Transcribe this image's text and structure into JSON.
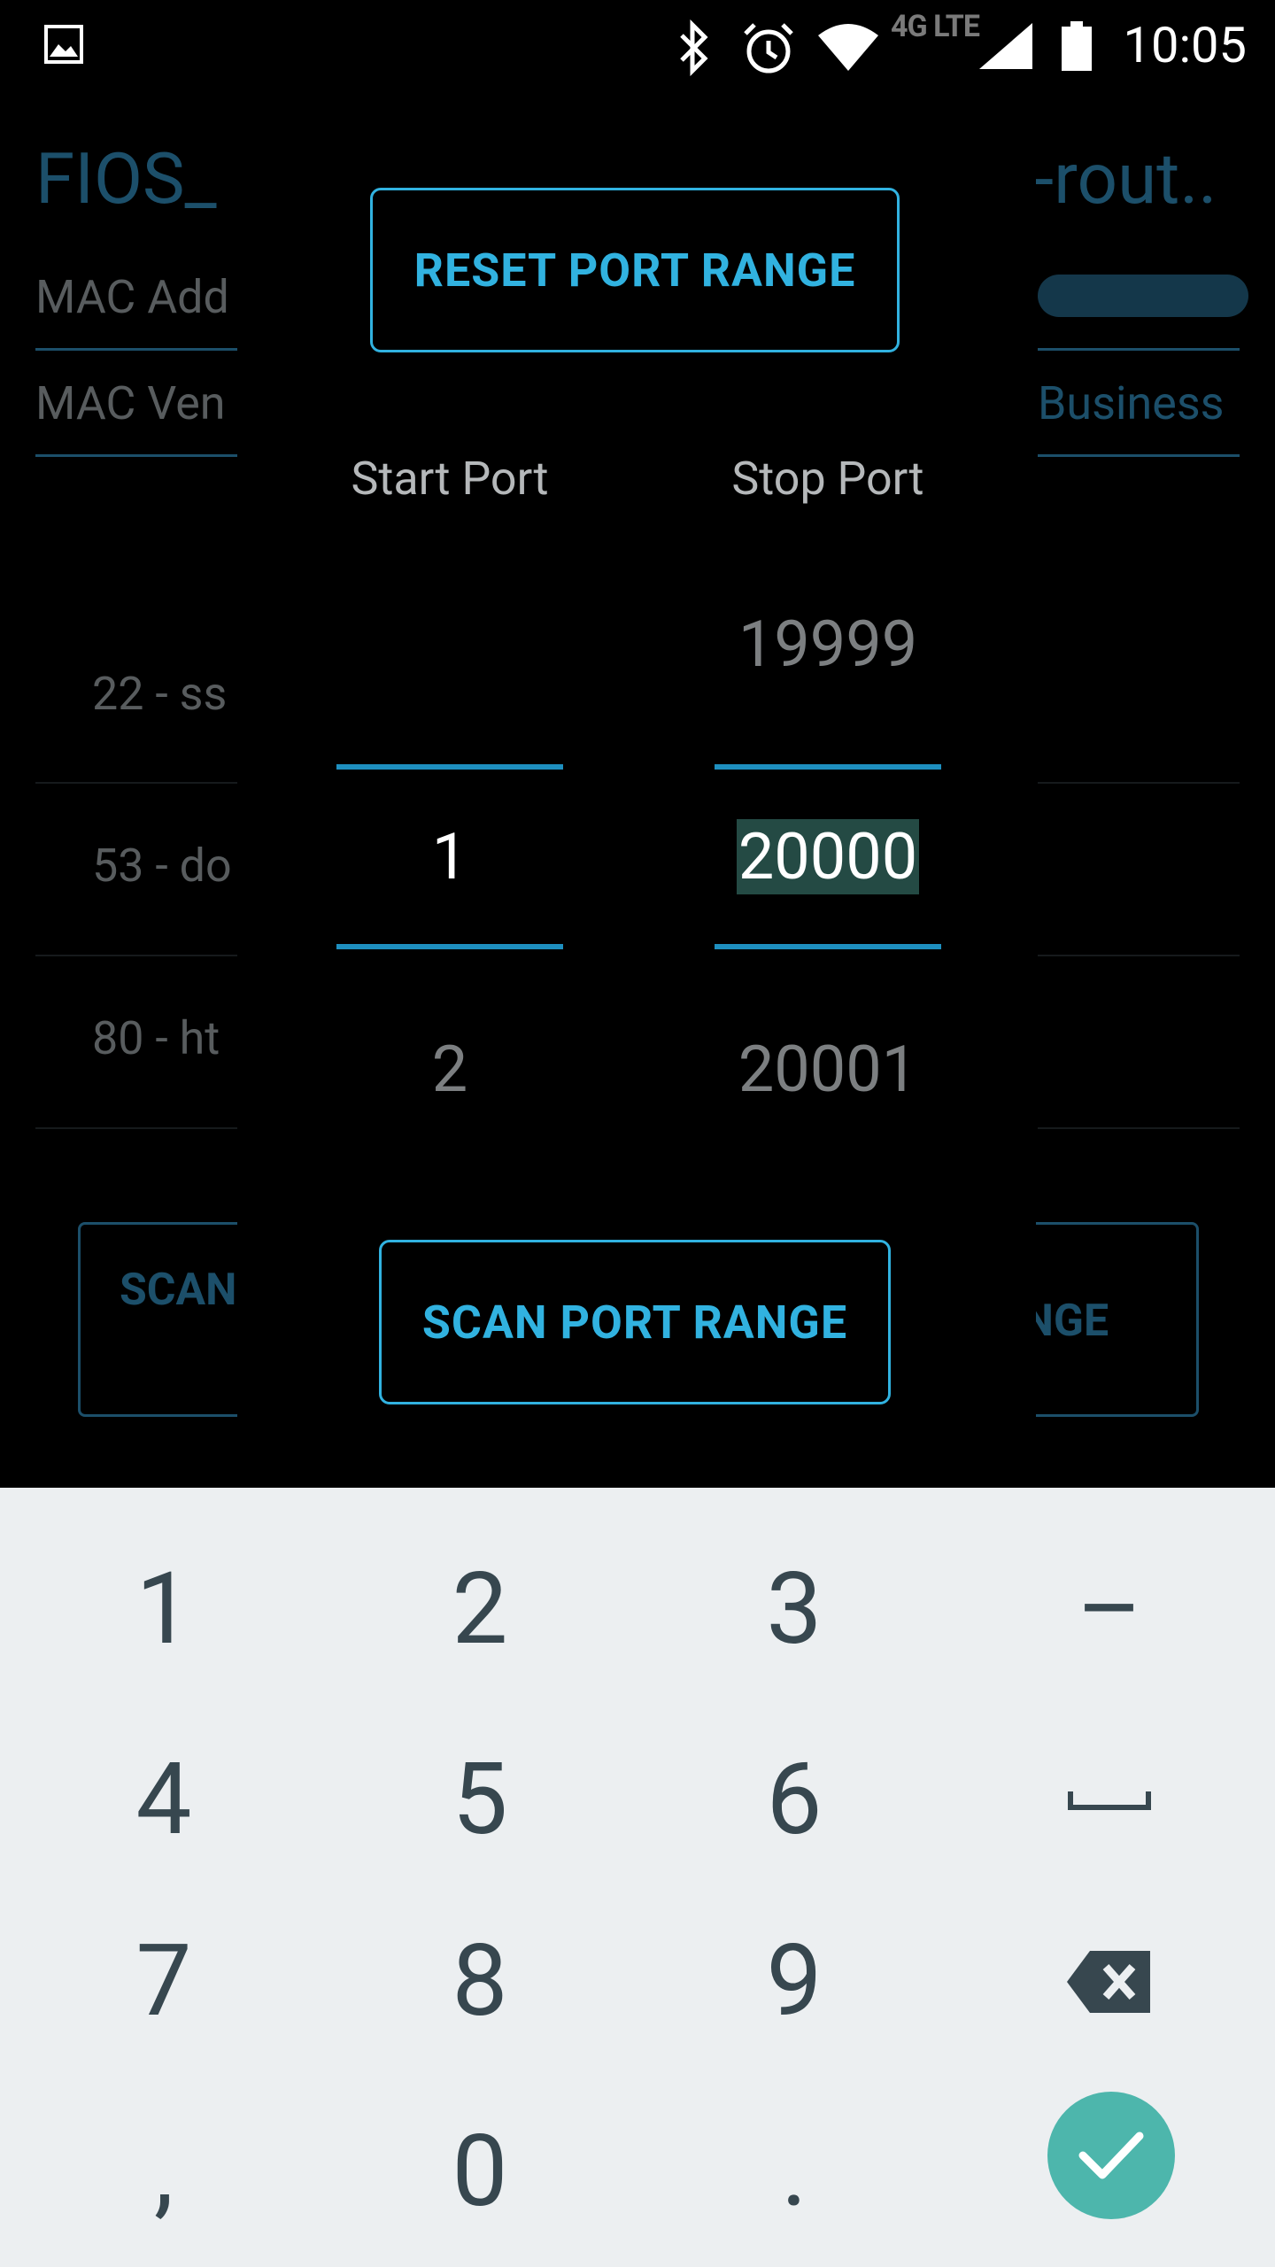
{
  "status_bar": {
    "time": "10:05",
    "network": "4G LTE"
  },
  "background": {
    "title_left": "FIOS_",
    "title_right": "-rout..",
    "mac_address_label": "MAC Add",
    "mac_vendor_label": "MAC Ven",
    "mac_vendor_value": "Business",
    "ports": [
      "22 - ss",
      "53 - do",
      "80 - ht"
    ],
    "scan_button": "SCAN",
    "right_button": "ANGE"
  },
  "dialog": {
    "reset_button": "RESET PORT RANGE",
    "start_label": "Start Port",
    "stop_label": "Stop Port",
    "start_picker": {
      "above": "",
      "selected": "1",
      "below": "2"
    },
    "stop_picker": {
      "above": "19999",
      "selected": "20000",
      "below": "20001"
    },
    "scan_button": "SCAN PORT RANGE"
  },
  "keyboard": {
    "rows": [
      [
        "1",
        "2",
        "3",
        "–"
      ],
      [
        "4",
        "5",
        "6",
        "space"
      ],
      [
        "7",
        "8",
        "9",
        "backspace"
      ],
      [
        ",",
        "0",
        ".",
        "done"
      ]
    ]
  },
  "colors": {
    "accent": "#31b2e0",
    "picker_line": "#1e8fbf",
    "selection_highlight": "#244a44",
    "dim_accent": "#1c4f6a",
    "keyboard_bg": "#eceff1",
    "keyboard_key": "#37474f",
    "done_button": "#4db6ac"
  }
}
